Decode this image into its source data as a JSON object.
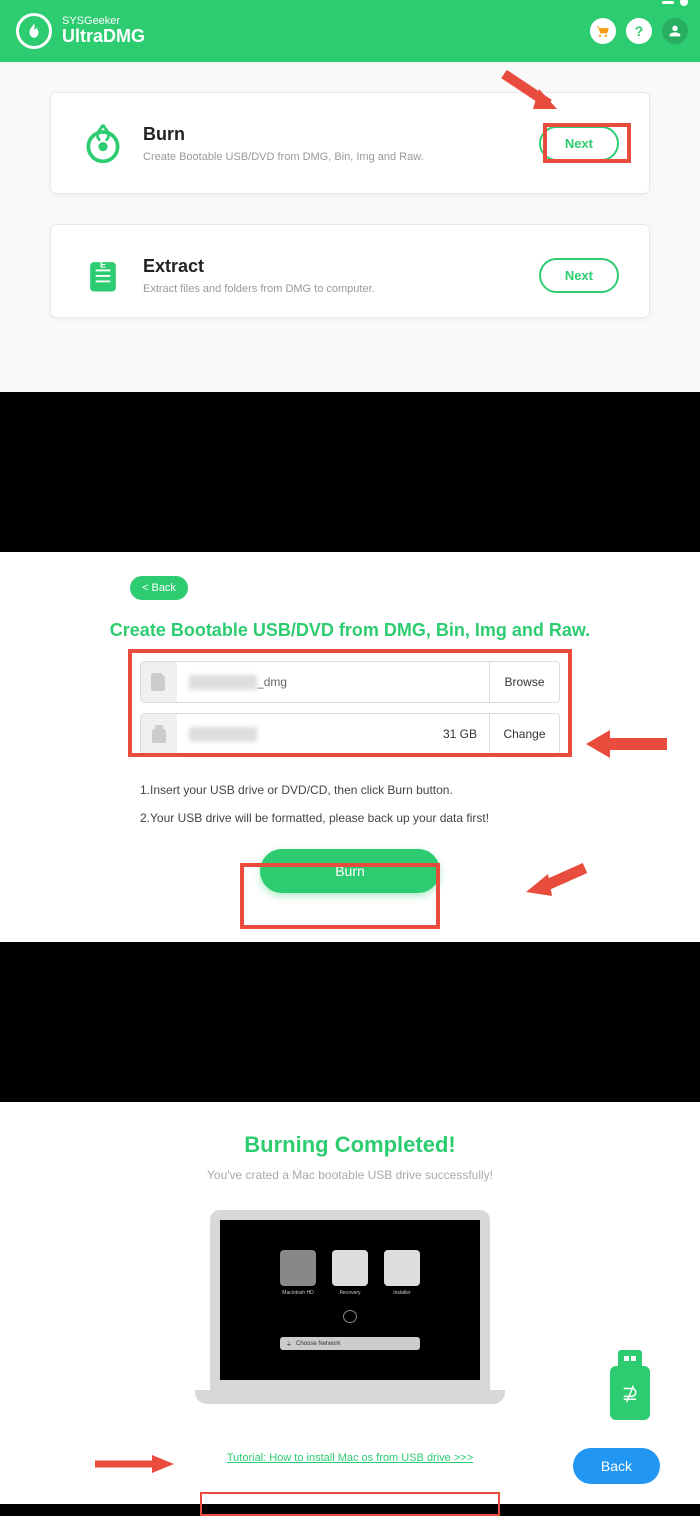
{
  "header": {
    "brand_top": "SYSGeeker",
    "brand_bottom": "UltraDMG"
  },
  "cards": {
    "burn": {
      "title": "Burn",
      "desc": "Create Bootable USB/DVD from DMG, Bin, Img and Raw.",
      "next": "Next"
    },
    "extract": {
      "title": "Extract",
      "desc": "Extract files and folders from DMG to computer.",
      "next": "Next"
    }
  },
  "burn_screen": {
    "back": "< Back",
    "title": "Create Bootable USB/DVD from DMG, Bin, Img and Raw.",
    "file_suffix": "_dmg",
    "drive_size": "31 GB",
    "browse": "Browse",
    "change": "Change",
    "instr1": "1.Insert your USB drive or DVD/CD, then click Burn button.",
    "instr2": "2.Your USB drive will be formatted, please back up your data first!",
    "burn_btn": "Burn"
  },
  "complete": {
    "title": "Burning Completed!",
    "subtitle": "You've crated a Mac bootable USB drive successfully!",
    "boot_select": "Choose Network",
    "tutorial": "Tutorial: How to install Mac os from USB drive >>>",
    "back": "Back"
  }
}
